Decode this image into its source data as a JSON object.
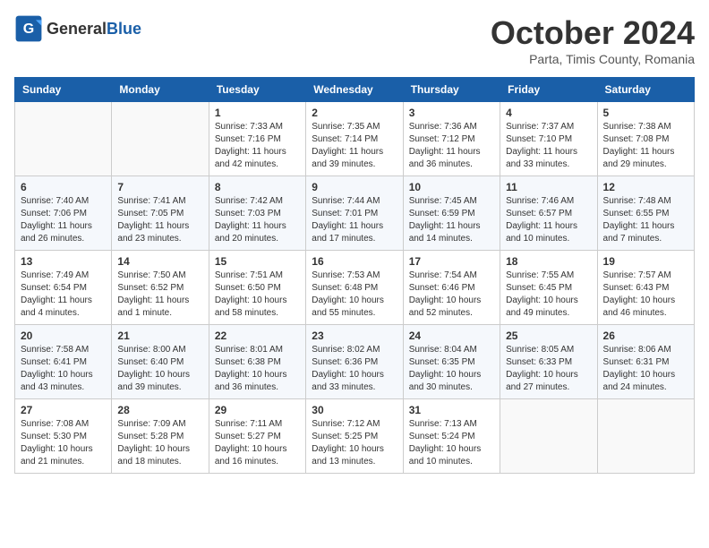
{
  "logo": {
    "general": "General",
    "blue": "Blue"
  },
  "title": "October 2024",
  "location": "Parta, Timis County, Romania",
  "weekdays": [
    "Sunday",
    "Monday",
    "Tuesday",
    "Wednesday",
    "Thursday",
    "Friday",
    "Saturday"
  ],
  "weeks": [
    [
      {
        "day": "",
        "info": ""
      },
      {
        "day": "",
        "info": ""
      },
      {
        "day": "1",
        "info": "Sunrise: 7:33 AM\nSunset: 7:16 PM\nDaylight: 11 hours and 42 minutes."
      },
      {
        "day": "2",
        "info": "Sunrise: 7:35 AM\nSunset: 7:14 PM\nDaylight: 11 hours and 39 minutes."
      },
      {
        "day": "3",
        "info": "Sunrise: 7:36 AM\nSunset: 7:12 PM\nDaylight: 11 hours and 36 minutes."
      },
      {
        "day": "4",
        "info": "Sunrise: 7:37 AM\nSunset: 7:10 PM\nDaylight: 11 hours and 33 minutes."
      },
      {
        "day": "5",
        "info": "Sunrise: 7:38 AM\nSunset: 7:08 PM\nDaylight: 11 hours and 29 minutes."
      }
    ],
    [
      {
        "day": "6",
        "info": "Sunrise: 7:40 AM\nSunset: 7:06 PM\nDaylight: 11 hours and 26 minutes."
      },
      {
        "day": "7",
        "info": "Sunrise: 7:41 AM\nSunset: 7:05 PM\nDaylight: 11 hours and 23 minutes."
      },
      {
        "day": "8",
        "info": "Sunrise: 7:42 AM\nSunset: 7:03 PM\nDaylight: 11 hours and 20 minutes."
      },
      {
        "day": "9",
        "info": "Sunrise: 7:44 AM\nSunset: 7:01 PM\nDaylight: 11 hours and 17 minutes."
      },
      {
        "day": "10",
        "info": "Sunrise: 7:45 AM\nSunset: 6:59 PM\nDaylight: 11 hours and 14 minutes."
      },
      {
        "day": "11",
        "info": "Sunrise: 7:46 AM\nSunset: 6:57 PM\nDaylight: 11 hours and 10 minutes."
      },
      {
        "day": "12",
        "info": "Sunrise: 7:48 AM\nSunset: 6:55 PM\nDaylight: 11 hours and 7 minutes."
      }
    ],
    [
      {
        "day": "13",
        "info": "Sunrise: 7:49 AM\nSunset: 6:54 PM\nDaylight: 11 hours and 4 minutes."
      },
      {
        "day": "14",
        "info": "Sunrise: 7:50 AM\nSunset: 6:52 PM\nDaylight: 11 hours and 1 minute."
      },
      {
        "day": "15",
        "info": "Sunrise: 7:51 AM\nSunset: 6:50 PM\nDaylight: 10 hours and 58 minutes."
      },
      {
        "day": "16",
        "info": "Sunrise: 7:53 AM\nSunset: 6:48 PM\nDaylight: 10 hours and 55 minutes."
      },
      {
        "day": "17",
        "info": "Sunrise: 7:54 AM\nSunset: 6:46 PM\nDaylight: 10 hours and 52 minutes."
      },
      {
        "day": "18",
        "info": "Sunrise: 7:55 AM\nSunset: 6:45 PM\nDaylight: 10 hours and 49 minutes."
      },
      {
        "day": "19",
        "info": "Sunrise: 7:57 AM\nSunset: 6:43 PM\nDaylight: 10 hours and 46 minutes."
      }
    ],
    [
      {
        "day": "20",
        "info": "Sunrise: 7:58 AM\nSunset: 6:41 PM\nDaylight: 10 hours and 43 minutes."
      },
      {
        "day": "21",
        "info": "Sunrise: 8:00 AM\nSunset: 6:40 PM\nDaylight: 10 hours and 39 minutes."
      },
      {
        "day": "22",
        "info": "Sunrise: 8:01 AM\nSunset: 6:38 PM\nDaylight: 10 hours and 36 minutes."
      },
      {
        "day": "23",
        "info": "Sunrise: 8:02 AM\nSunset: 6:36 PM\nDaylight: 10 hours and 33 minutes."
      },
      {
        "day": "24",
        "info": "Sunrise: 8:04 AM\nSunset: 6:35 PM\nDaylight: 10 hours and 30 minutes."
      },
      {
        "day": "25",
        "info": "Sunrise: 8:05 AM\nSunset: 6:33 PM\nDaylight: 10 hours and 27 minutes."
      },
      {
        "day": "26",
        "info": "Sunrise: 8:06 AM\nSunset: 6:31 PM\nDaylight: 10 hours and 24 minutes."
      }
    ],
    [
      {
        "day": "27",
        "info": "Sunrise: 7:08 AM\nSunset: 5:30 PM\nDaylight: 10 hours and 21 minutes."
      },
      {
        "day": "28",
        "info": "Sunrise: 7:09 AM\nSunset: 5:28 PM\nDaylight: 10 hours and 18 minutes."
      },
      {
        "day": "29",
        "info": "Sunrise: 7:11 AM\nSunset: 5:27 PM\nDaylight: 10 hours and 16 minutes."
      },
      {
        "day": "30",
        "info": "Sunrise: 7:12 AM\nSunset: 5:25 PM\nDaylight: 10 hours and 13 minutes."
      },
      {
        "day": "31",
        "info": "Sunrise: 7:13 AM\nSunset: 5:24 PM\nDaylight: 10 hours and 10 minutes."
      },
      {
        "day": "",
        "info": ""
      },
      {
        "day": "",
        "info": ""
      }
    ]
  ]
}
